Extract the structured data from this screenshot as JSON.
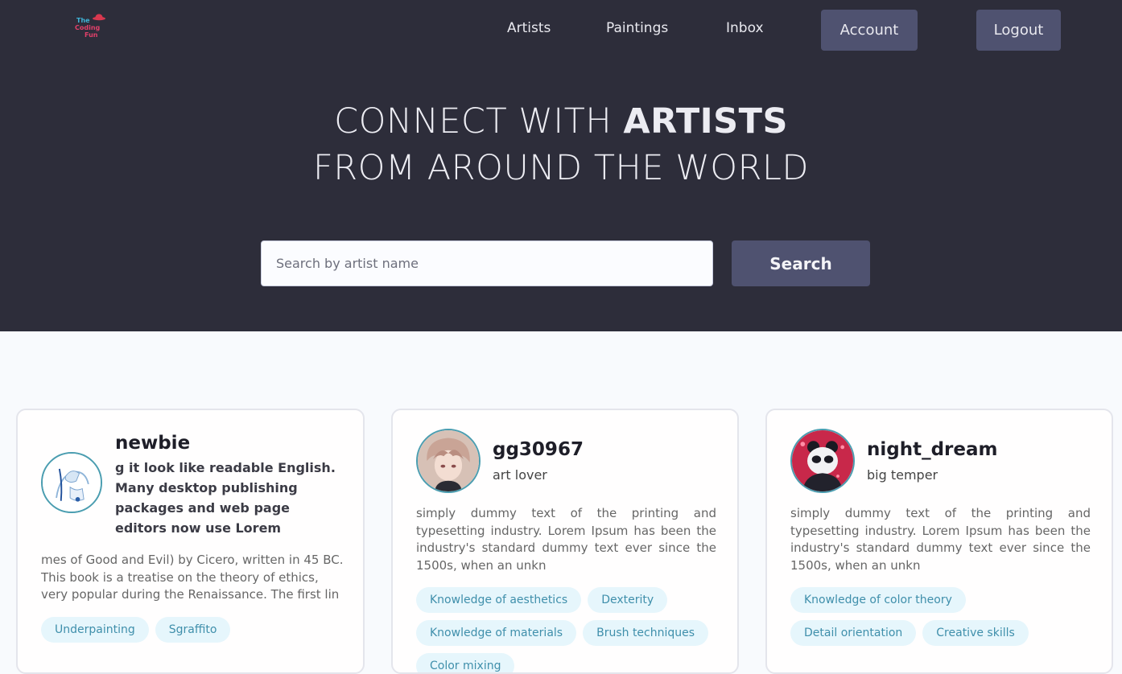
{
  "brand": {
    "logo_line1": "The",
    "logo_line2": "Coding",
    "logo_line3": "Fun"
  },
  "nav": {
    "artists": "Artists",
    "paintings": "Paintings",
    "inbox": "Inbox",
    "account": "Account",
    "logout": "Logout"
  },
  "hero": {
    "line1_prefix": "CONNECT WITH ",
    "line1_bold": "ARTISTS",
    "line2": "FROM AROUND THE WORLD"
  },
  "search": {
    "placeholder": "Search by artist name",
    "button": "Search"
  },
  "artists": [
    {
      "username": "newbie",
      "tagline": "g it look like readable English. Many desktop publishing packages and web page editors now use Lorem",
      "description": "mes of Good and Evil) by Cicero, written in 45 BC. This book is a treatise on the theory of ethics, very popular during the Renaissance. The first lin",
      "skills": [
        "Underpainting",
        "Sgraffito"
      ]
    },
    {
      "username": "gg30967",
      "tagline": "art lover",
      "description": "simply dummy text of the printing and typesetting industry. Lorem Ipsum has been the industry's standard dummy text ever since the 1500s, when an unkn",
      "skills": [
        "Knowledge of aesthetics",
        "Dexterity",
        "Knowledge of materials",
        "Brush techniques",
        "Color mixing"
      ]
    },
    {
      "username": "night_dream",
      "tagline": "big temper",
      "description": "simply dummy text of the printing and typesetting industry. Lorem Ipsum has been the industry's standard dummy text ever since the 1500s, when an unkn",
      "skills": [
        "Knowledge of color theory",
        "Detail orientation",
        "Creative skills"
      ]
    }
  ],
  "colors": {
    "hero_bg": "#2d2d3a",
    "button_bg": "#4f5270",
    "page_bg": "#f8fafd",
    "tag_bg": "#e6f6fc",
    "tag_text": "#3f8fab",
    "avatar_ring": "#4a9db0"
  }
}
